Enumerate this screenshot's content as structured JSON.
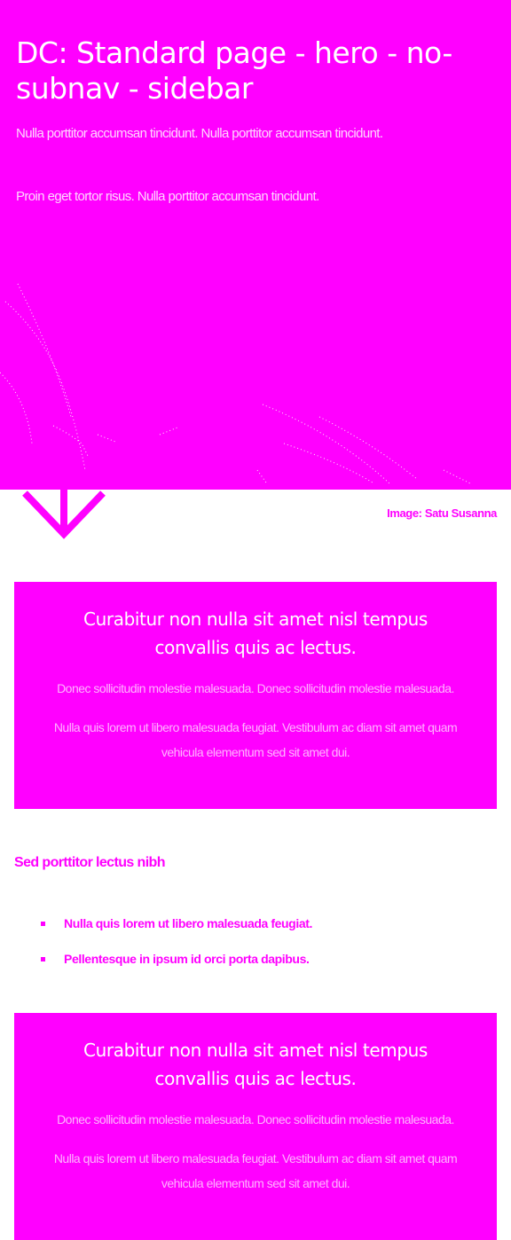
{
  "hero": {
    "title": "DC: Standard page - hero - no-subnav - sidebar",
    "paragraphs": [
      "Nulla porttitor accumsan tincidunt. Nulla porttitor accumsan tincidunt.",
      "Proin eget tortor risus. Nulla porttitor accumsan tincidunt."
    ],
    "background_color": "#ff00ff",
    "image_credit": "Image: Satu Susanna"
  },
  "scroll_arrow": {
    "icon": "chevron-down-icon"
  },
  "callouts": [
    {
      "title": "Curabitur non nulla sit amet nisl tempus convallis quis ac lectus.",
      "paragraphs": [
        "Donec sollicitudin molestie malesuada. Donec sollicitudin molestie malesuada.",
        "Nulla quis lorem ut libero malesuada feugiat. Vestibulum ac diam sit amet quam vehicula elementum sed sit amet dui."
      ]
    },
    {
      "title": "Curabitur non nulla sit amet nisl tempus convallis quis ac lectus.",
      "paragraphs": [
        "Donec sollicitudin molestie malesuada. Donec sollicitudin molestie malesuada.",
        "Nulla quis lorem ut libero malesuada feugiat. Vestibulum ac diam sit amet quam vehicula elementum sed sit amet dui."
      ]
    }
  ],
  "section": {
    "heading": "Sed porttitor lectus nibh",
    "bullets": [
      "Nulla quis lorem ut libero malesuada feugiat.",
      "Pellentesque in ipsum id orci porta dapibus."
    ]
  },
  "colors": {
    "accent": "#ff00ff",
    "text_on_accent": "#ffffff"
  }
}
